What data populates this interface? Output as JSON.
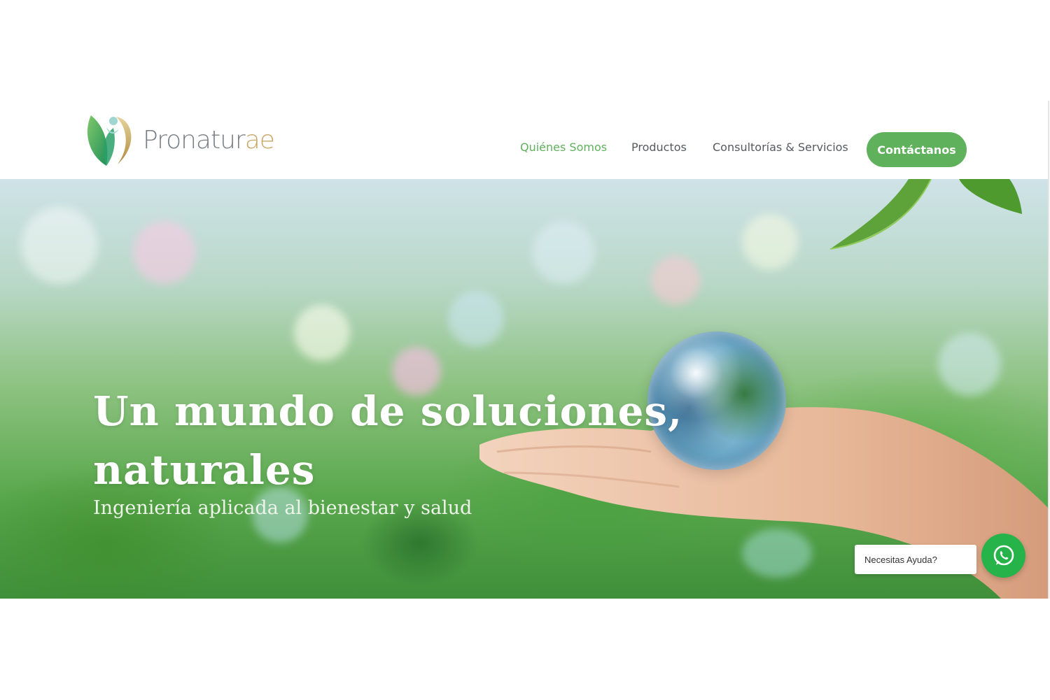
{
  "brand": {
    "name_main": "Pronatur",
    "name_suffix": "ae",
    "green": "#5fb15c",
    "gold": "#c8a96a"
  },
  "nav": {
    "items": [
      {
        "label": "Quiénes Somos",
        "active": true
      },
      {
        "label": "Productos",
        "active": false
      },
      {
        "label": "Consultorías & Servicios",
        "active": false
      }
    ],
    "cta_label": "Contáctanos"
  },
  "hero": {
    "title_line1": "Un mundo de soluciones,",
    "title_line2": "naturales",
    "subtitle": "Ingeniería aplicada al bienestar y salud"
  },
  "whatsapp": {
    "bubble_text": "Necesitas Ayuda?",
    "icon": "whatsapp-icon",
    "color": "#25b34a"
  }
}
